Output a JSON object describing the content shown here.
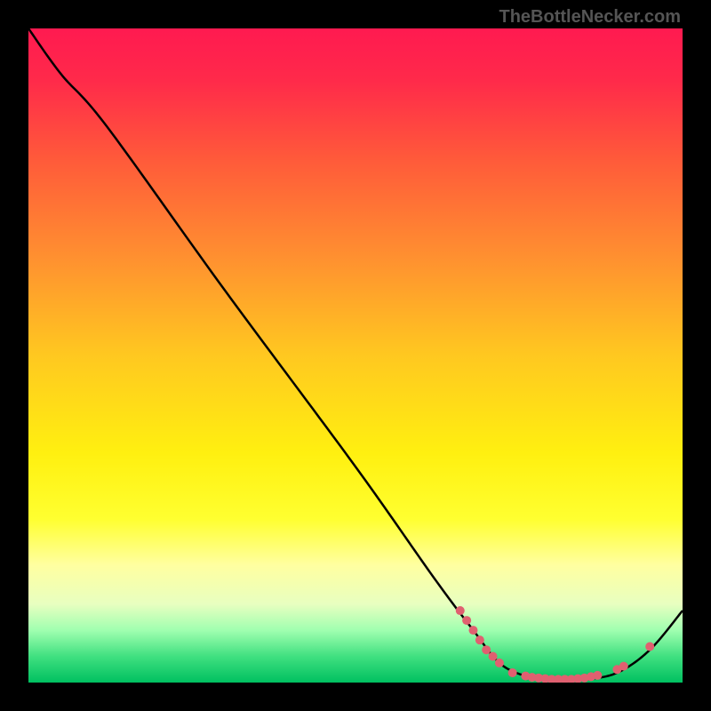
{
  "watermark": "TheBottleNecker.com",
  "chart_data": {
    "type": "line",
    "title": "",
    "xlabel": "",
    "ylabel": "",
    "xlim": [
      0,
      100
    ],
    "ylim": [
      0,
      100
    ],
    "gradient_stops": [
      {
        "offset": 0,
        "color": "#ff1a50"
      },
      {
        "offset": 8,
        "color": "#ff2a4a"
      },
      {
        "offset": 20,
        "color": "#ff5a3a"
      },
      {
        "offset": 35,
        "color": "#ff9030"
      },
      {
        "offset": 50,
        "color": "#ffc820"
      },
      {
        "offset": 65,
        "color": "#fff010"
      },
      {
        "offset": 75,
        "color": "#ffff30"
      },
      {
        "offset": 82,
        "color": "#ffffa0"
      },
      {
        "offset": 88,
        "color": "#e8ffc0"
      },
      {
        "offset": 92,
        "color": "#a0ffb0"
      },
      {
        "offset": 96,
        "color": "#40e080"
      },
      {
        "offset": 100,
        "color": "#00c060"
      }
    ],
    "series": [
      {
        "name": "bottleneck-curve",
        "points": [
          {
            "x": 0,
            "y": 100
          },
          {
            "x": 5,
            "y": 93
          },
          {
            "x": 12,
            "y": 85
          },
          {
            "x": 30,
            "y": 60
          },
          {
            "x": 50,
            "y": 33
          },
          {
            "x": 62,
            "y": 16
          },
          {
            "x": 68,
            "y": 8
          },
          {
            "x": 72,
            "y": 3
          },
          {
            "x": 76,
            "y": 1
          },
          {
            "x": 80,
            "y": 0.5
          },
          {
            "x": 85,
            "y": 0.5
          },
          {
            "x": 90,
            "y": 1.5
          },
          {
            "x": 95,
            "y": 5
          },
          {
            "x": 100,
            "y": 11
          }
        ]
      }
    ],
    "markers": [
      {
        "x": 66,
        "y": 11
      },
      {
        "x": 67,
        "y": 9.5
      },
      {
        "x": 68,
        "y": 8
      },
      {
        "x": 69,
        "y": 6.5
      },
      {
        "x": 70,
        "y": 5
      },
      {
        "x": 71,
        "y": 4
      },
      {
        "x": 72,
        "y": 3
      },
      {
        "x": 74,
        "y": 1.5
      },
      {
        "x": 76,
        "y": 1
      },
      {
        "x": 77,
        "y": 0.8
      },
      {
        "x": 78,
        "y": 0.7
      },
      {
        "x": 79,
        "y": 0.6
      },
      {
        "x": 80,
        "y": 0.5
      },
      {
        "x": 81,
        "y": 0.5
      },
      {
        "x": 82,
        "y": 0.5
      },
      {
        "x": 83,
        "y": 0.5
      },
      {
        "x": 84,
        "y": 0.6
      },
      {
        "x": 85,
        "y": 0.7
      },
      {
        "x": 86,
        "y": 0.9
      },
      {
        "x": 87,
        "y": 1.1
      },
      {
        "x": 90,
        "y": 2
      },
      {
        "x": 91,
        "y": 2.5
      },
      {
        "x": 95,
        "y": 5.5
      }
    ],
    "marker_color": "#e06070"
  }
}
